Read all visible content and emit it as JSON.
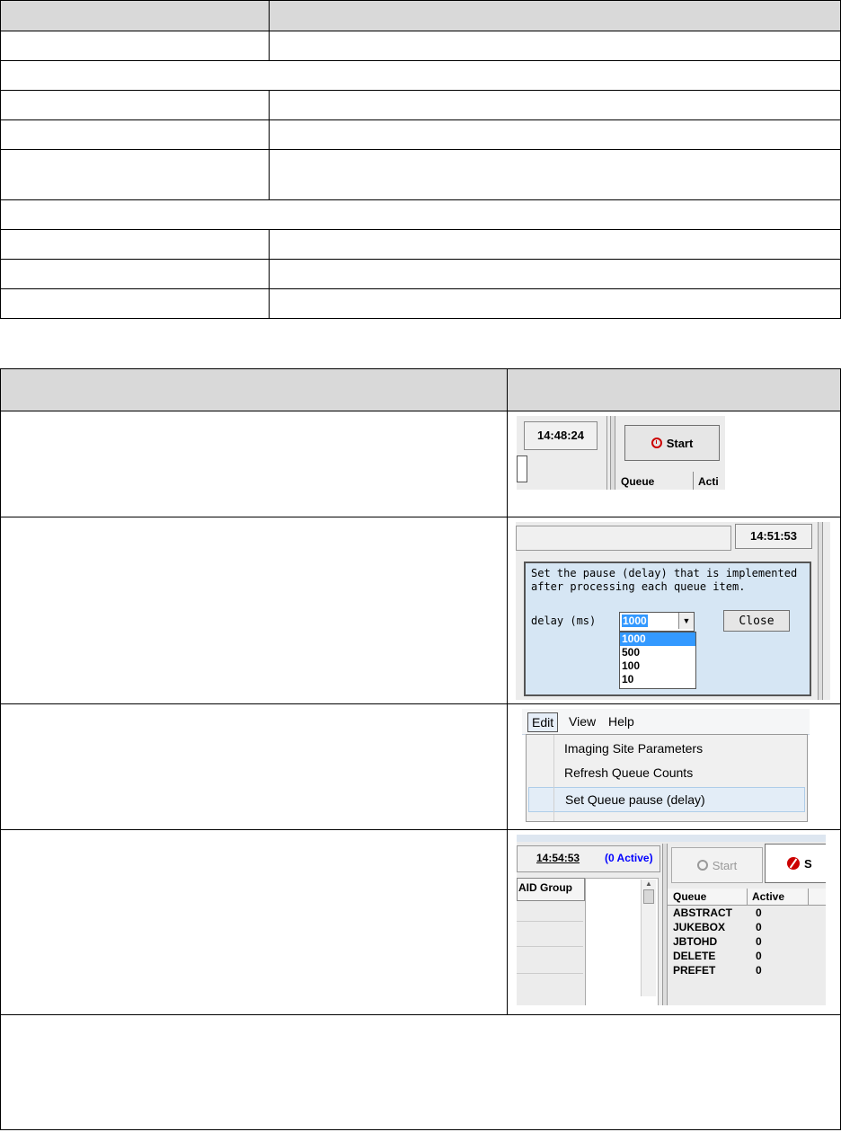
{
  "shot1": {
    "time": "14:48:24",
    "start_label": "Start",
    "queue_header": "Queue",
    "active_header": "Acti"
  },
  "shot2": {
    "time": "14:51:53",
    "line1": "Set the pause (delay)  that is implemented",
    "line2": "after processing each queue item.",
    "delay_label": "delay (ms)",
    "selected": "1000",
    "close_label": "Close",
    "options": [
      "1000",
      "500",
      "100",
      "10"
    ]
  },
  "shot3": {
    "menubar": [
      "Edit",
      "View",
      "Help"
    ],
    "menu_items": [
      "Imaging Site Parameters",
      "Refresh Queue Counts",
      "Set Queue pause (delay)"
    ]
  },
  "shot4": {
    "time": "14:54:53",
    "active_count": "(0 Active)",
    "group_header": "AID Group",
    "start_label": "Start",
    "stop_label": "S",
    "queue_header": "Queue",
    "active_header": "Active",
    "rows": [
      {
        "queue": "ABSTRACT",
        "active": "0"
      },
      {
        "queue": "JUKEBOX",
        "active": "0"
      },
      {
        "queue": "JBTOHD",
        "active": "0"
      },
      {
        "queue": "DELETE",
        "active": "0"
      },
      {
        "queue": "PREFET",
        "active": "0"
      }
    ]
  }
}
